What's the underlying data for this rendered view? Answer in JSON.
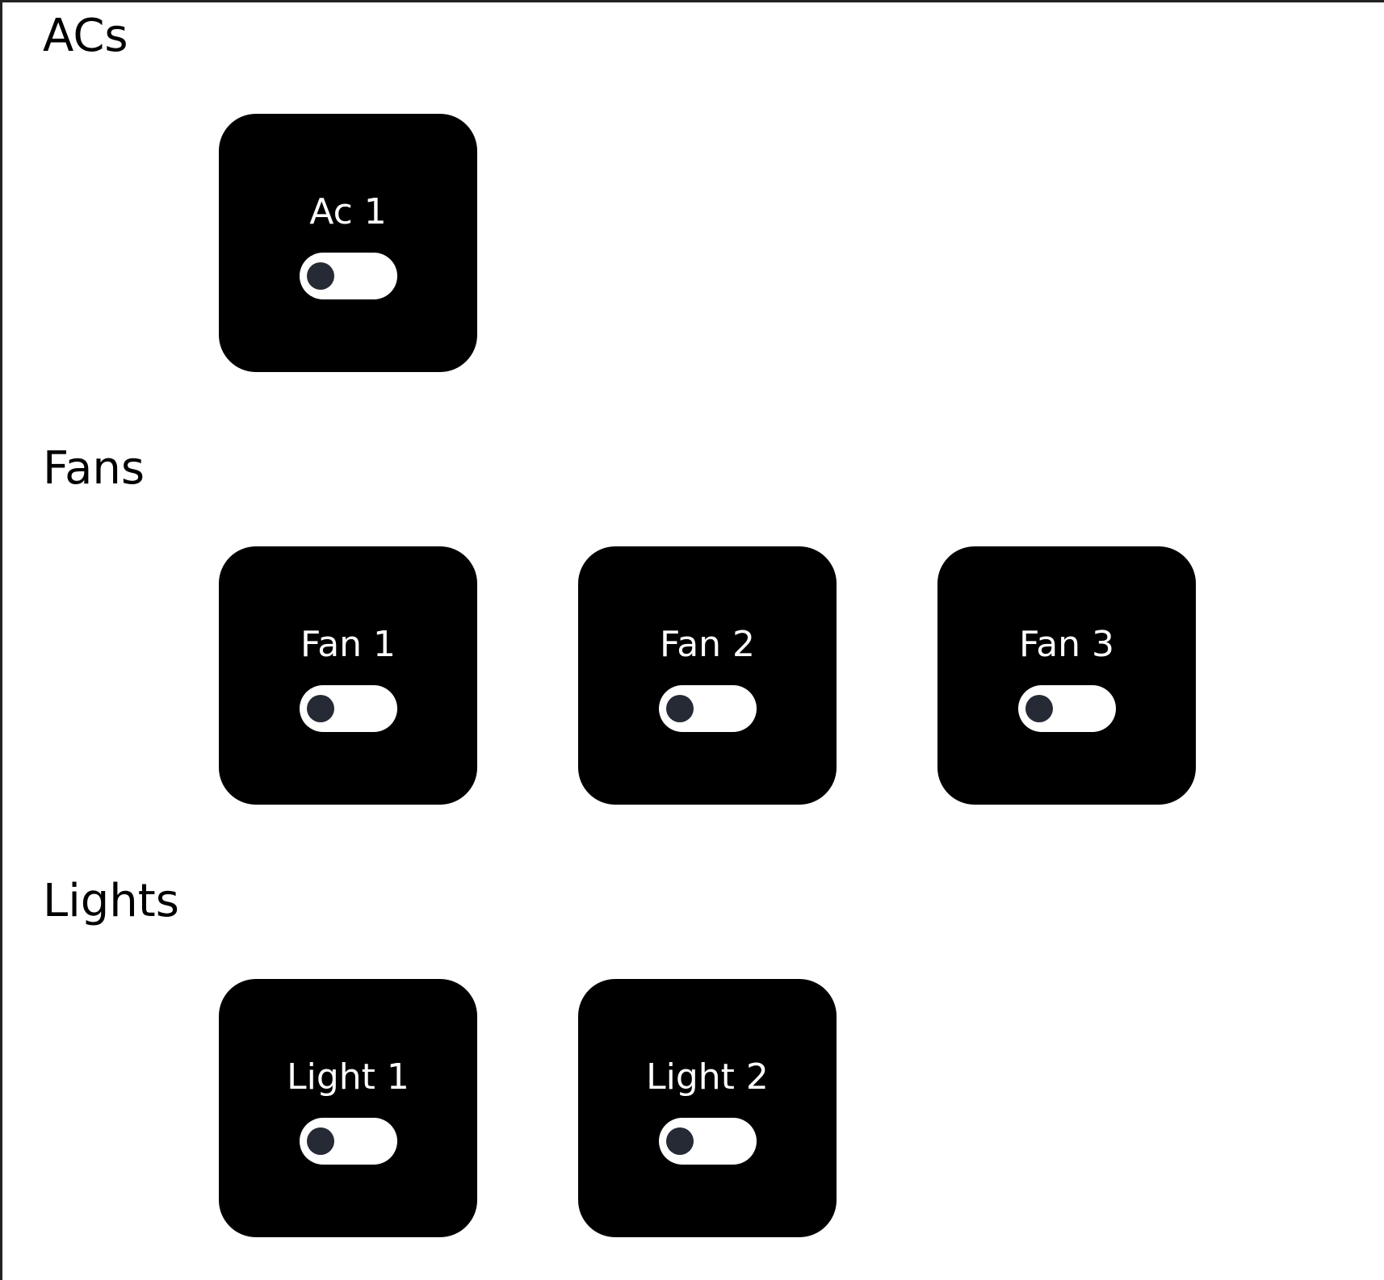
{
  "sections": [
    {
      "title": "ACs",
      "devices": [
        {
          "name": "Ac 1",
          "on": false
        }
      ]
    },
    {
      "title": "Fans",
      "devices": [
        {
          "name": "Fan 1",
          "on": false
        },
        {
          "name": "Fan 2",
          "on": false
        },
        {
          "name": "Fan 3",
          "on": false
        }
      ]
    },
    {
      "title": "Lights",
      "devices": [
        {
          "name": "Light 1",
          "on": false
        },
        {
          "name": "Light 2",
          "on": false
        }
      ]
    }
  ],
  "colors": {
    "card_background": "#000000",
    "toggle_track": "#ffffff",
    "toggle_knob": "#252a35"
  }
}
